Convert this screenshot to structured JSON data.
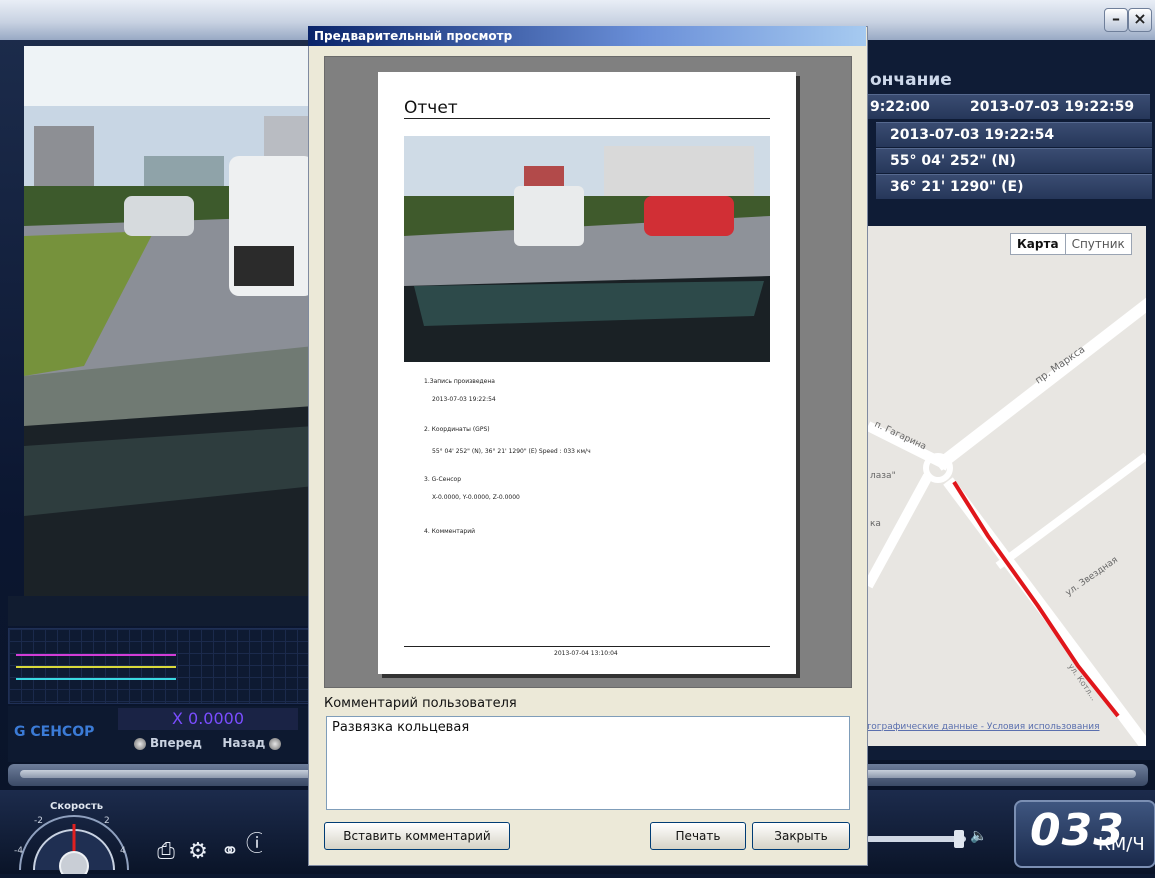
{
  "app": {
    "g_sensor_label": "G СЕНСОР",
    "g_x_value": "X 0.0000",
    "forward_label": "Вперед",
    "back_label": "Назад",
    "speed_gauge_label": "Скорость",
    "gauge_ticks": [
      "-2",
      "2",
      "-4",
      "4"
    ],
    "speed_value": "033",
    "speed_unit": "КМ/Ч",
    "toolbar_icons": [
      "print-icon",
      "gear-icon",
      "tools-icon",
      "info-icon"
    ],
    "colors": {
      "accent": "#3b7bd6",
      "gx": "#7a4dff",
      "route": "#e0161b"
    }
  },
  "info": {
    "end_header": "ончание",
    "rows": [
      {
        "left": "9:22:00",
        "right": "2013-07-03 19:22:59"
      },
      {
        "left": "",
        "right": "2013-07-03 19:22:54"
      },
      {
        "left": "",
        "right": "55° 04' 252\" (N)"
      },
      {
        "left": "",
        "right": "36° 21' 1290\" (E)"
      }
    ]
  },
  "map": {
    "map_button": "Карта",
    "satellite_button": "Спутник",
    "streets": [
      "пр. Маркса",
      "п. Гагарина",
      "лаза\"",
      "ка",
      "ул. Звездная",
      "ул. Котл..."
    ],
    "footer_links": "тографические данные - Условия использования"
  },
  "dialog": {
    "title": "Предварительный просмотр",
    "report_title": "Отчет",
    "report_lines": [
      "1.Запись произведена",
      "2013-07-03  19:22:54",
      "2. Координаты (GPS)",
      "55° 04' 252\" (N), 36° 21' 1290\" (E)      Speed : 033 км/ч",
      "3. G-Сенсор",
      "X-0.0000,  Y-0.0000,  Z-0.0000",
      "4. Комментарий"
    ],
    "report_footer": "2013-07-04  13:10:04",
    "comment_label": "Комментарий пользователя",
    "comment_text": "Развязка кольцевая",
    "insert_button": "Вставить комментарий",
    "print_button": "Печать",
    "close_button": "Закрыть"
  }
}
